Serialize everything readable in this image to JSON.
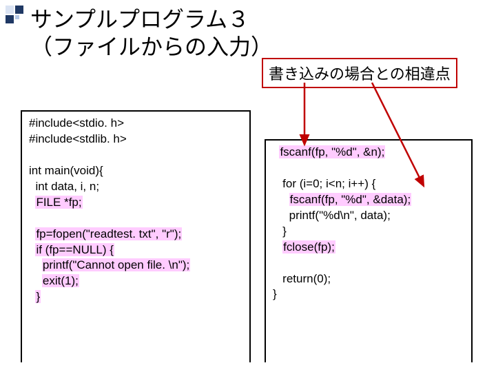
{
  "title_line1": "サンプルプログラム３",
  "title_line2": "（ファイルからの入力）",
  "note": "書き込みの場合との相違点",
  "code_left": {
    "l1": "#include<stdio. h>",
    "l2": "#include<stdlib. h>",
    "l3": "int main(void){",
    "l4": "  int data, i, n;",
    "l5_a": "  ",
    "l5_h": "FILE *fp;",
    "l6_a": "  ",
    "l6_h": "fp=fopen(\"readtest. txt\", \"r\");",
    "l7_a": "  ",
    "l7_h": "if (fp==NULL) {",
    "l8_a": "    ",
    "l8_h": "printf(\"Cannot open file. \\n\");",
    "l9_a": "    ",
    "l9_h": "exit(1);",
    "l10_a": "  ",
    "l10_h": "}"
  },
  "code_right": {
    "l1_a": "  ",
    "l1_h": "fscanf(fp, \"%d\", &n);",
    "l2": "   for (i=0; i<n; i++) {",
    "l3_a": "     ",
    "l3_h": "fscanf(fp, \"%d\", &data);",
    "l4": "     printf(\"%d\\n\", data);",
    "l5": "   }",
    "l6_a": "   ",
    "l6_h": "fclose(fp);",
    "l7": "   return(0);",
    "l8": "}"
  }
}
